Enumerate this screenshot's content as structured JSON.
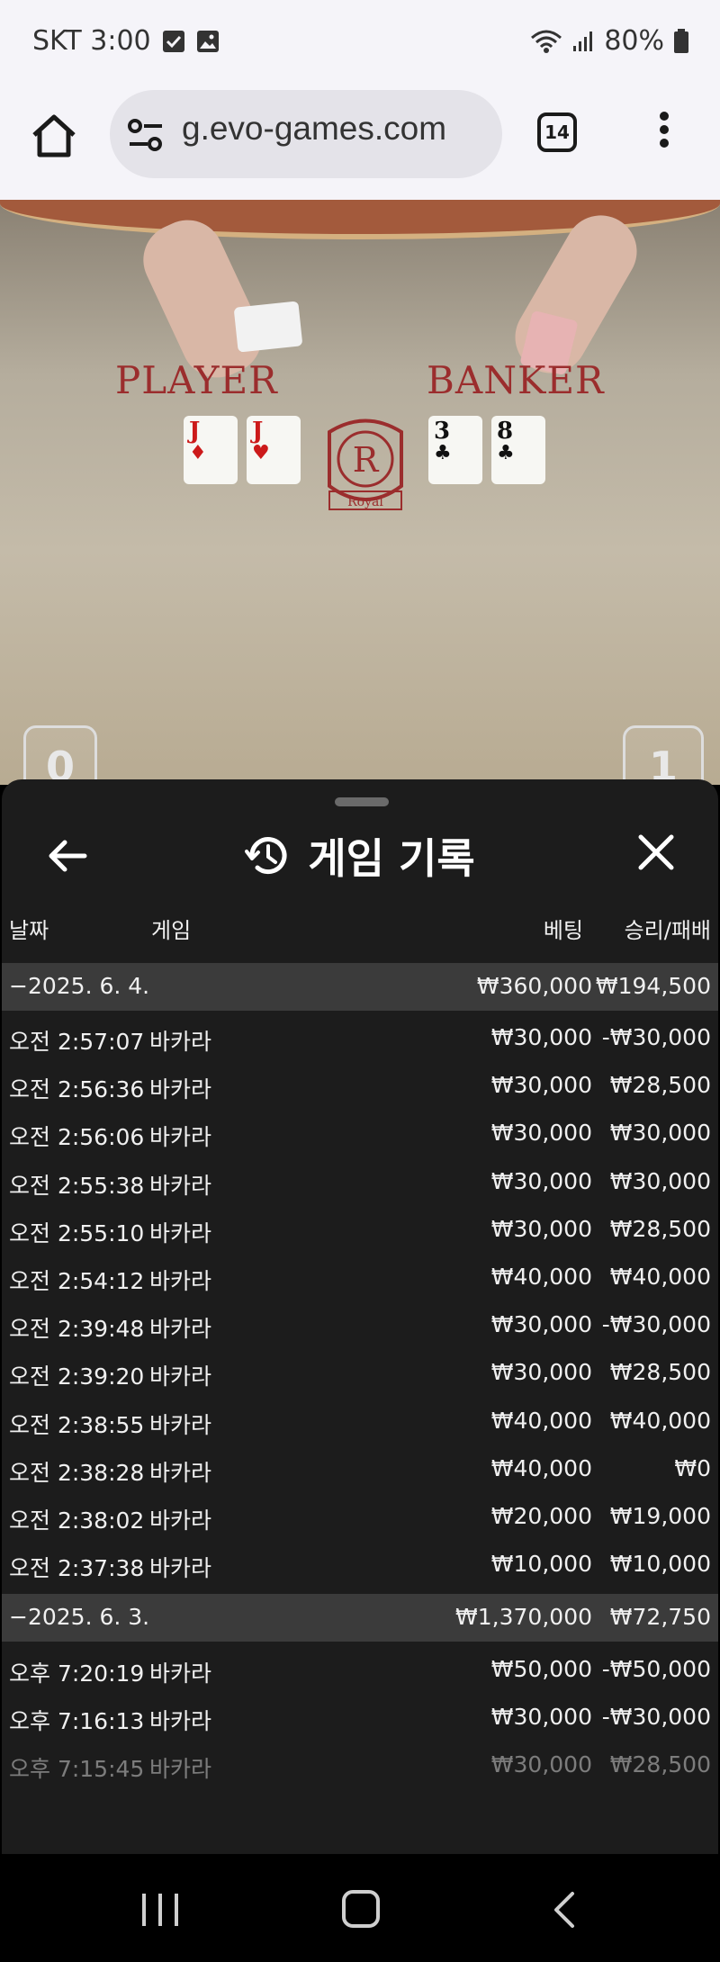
{
  "status_bar": {
    "carrier_time": "SKT 3:00",
    "battery": "80%",
    "icons": [
      "checkbox-notification-icon",
      "image-notification-icon",
      "wifi-icon",
      "signal-icon",
      "battery-icon"
    ]
  },
  "browser": {
    "url": "g.evo-games.com",
    "tab_count": "14"
  },
  "game_view": {
    "player_label": "PLAYER",
    "banker_label": "BANKER",
    "crest_letter": "R",
    "crest_text": "Royal",
    "player_score": "0",
    "banker_score": "1",
    "player_cards": [
      {
        "rank": "J",
        "suit": "♦"
      },
      {
        "rank": "J",
        "suit": "♥"
      }
    ],
    "banker_cards": [
      {
        "rank": "3",
        "suit": "♣"
      },
      {
        "rank": "8",
        "suit": "♣"
      }
    ]
  },
  "panel": {
    "title": "게임 기록",
    "columns": {
      "date": "날짜",
      "game": "게임",
      "bet": "베팅",
      "result": "승리/패배"
    },
    "group1": {
      "date": "−2025. 6. 4.",
      "bet": "₩360,000",
      "result": "₩194,500"
    },
    "rows1": [
      {
        "time": "오전 2:57:07",
        "game": "바카라",
        "bet": "₩30,000",
        "result": "-₩30,000"
      },
      {
        "time": "오전 2:56:36",
        "game": "바카라",
        "bet": "₩30,000",
        "result": "₩28,500"
      },
      {
        "time": "오전 2:56:06",
        "game": "바카라",
        "bet": "₩30,000",
        "result": "₩30,000"
      },
      {
        "time": "오전 2:55:38",
        "game": "바카라",
        "bet": "₩30,000",
        "result": "₩30,000"
      },
      {
        "time": "오전 2:55:10",
        "game": "바카라",
        "bet": "₩30,000",
        "result": "₩28,500"
      },
      {
        "time": "오전 2:54:12",
        "game": "바카라",
        "bet": "₩40,000",
        "result": "₩40,000"
      },
      {
        "time": "오전 2:39:48",
        "game": "바카라",
        "bet": "₩30,000",
        "result": "-₩30,000"
      },
      {
        "time": "오전 2:39:20",
        "game": "바카라",
        "bet": "₩30,000",
        "result": "₩28,500"
      },
      {
        "time": "오전 2:38:55",
        "game": "바카라",
        "bet": "₩40,000",
        "result": "₩40,000"
      },
      {
        "time": "오전 2:38:28",
        "game": "바카라",
        "bet": "₩40,000",
        "result": "₩0"
      },
      {
        "time": "오전 2:38:02",
        "game": "바카라",
        "bet": "₩20,000",
        "result": "₩19,000"
      },
      {
        "time": "오전 2:37:38",
        "game": "바카라",
        "bet": "₩10,000",
        "result": "₩10,000"
      }
    ],
    "group2": {
      "date": "−2025. 6. 3.",
      "bet": "₩1,370,000",
      "result": "₩72,750"
    },
    "rows2": [
      {
        "time": "오후 7:20:19",
        "game": "바카라",
        "bet": "₩50,000",
        "result": "-₩50,000"
      },
      {
        "time": "오후 7:16:13",
        "game": "바카라",
        "bet": "₩30,000",
        "result": "-₩30,000"
      },
      {
        "time": "오후 7:15:45",
        "game": "바카라",
        "bet": "₩30,000",
        "result": "₩28,500"
      }
    ]
  }
}
